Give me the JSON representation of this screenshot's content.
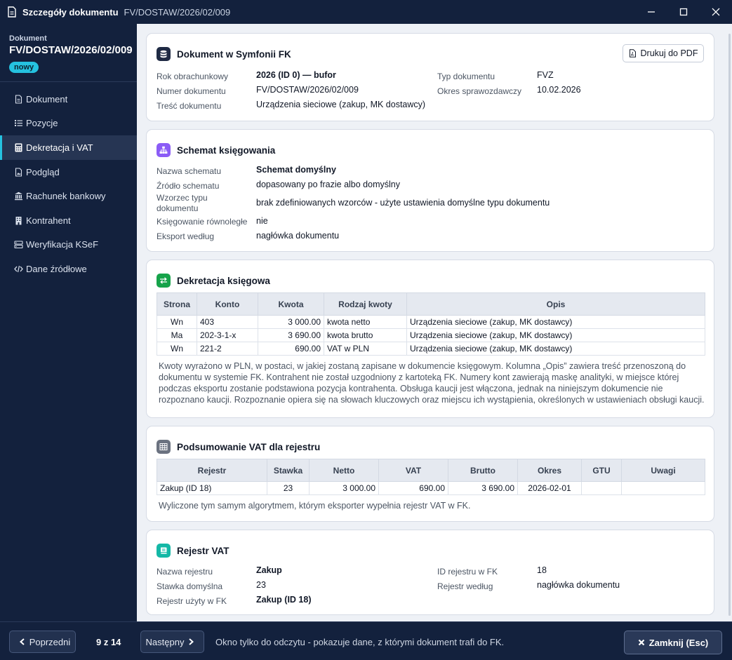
{
  "window": {
    "title": "Szczegóły dokumentu",
    "subtitle": "FV/DOSTAW/2026/02/009"
  },
  "sidebar": {
    "label": "Dokument",
    "doc_number": "FV/DOSTAW/2026/02/009",
    "badge": "nowy",
    "items": [
      {
        "label": "Dokument",
        "icon": "document-icon"
      },
      {
        "label": "Pozycje",
        "icon": "list-icon"
      },
      {
        "label": "Dekretacja i VAT",
        "icon": "calculator-icon",
        "active": true
      },
      {
        "label": "Podgląd",
        "icon": "image-icon"
      },
      {
        "label": "Rachunek bankowy",
        "icon": "bank-icon"
      },
      {
        "label": "Kontrahent",
        "icon": "building-icon"
      },
      {
        "label": "Weryfikacja KSeF",
        "icon": "server-icon"
      },
      {
        "label": "Dane źródłowe",
        "icon": "code-icon"
      }
    ]
  },
  "card1": {
    "title": "Dokument w Symfonii FK",
    "pdf_button": "Drukuj do PDF",
    "fields": {
      "rok_k": "Rok obrachunkowy",
      "rok_v": "2026 (ID 0) — bufor",
      "numer_k": "Numer dokumentu",
      "numer_v": "FV/DOSTAW/2026/02/009",
      "tresc_k": "Treść dokumentu",
      "tresc_v": "Urządzenia sieciowe (zakup, MK dostawcy)",
      "typ_k": "Typ dokumentu",
      "typ_v": "FVZ",
      "okres_k": "Okres sprawozdawczy",
      "okres_v": "10.02.2026"
    }
  },
  "card2": {
    "title": "Schemat księgowania",
    "fields": {
      "nazwa_k": "Nazwa schematu",
      "nazwa_v": "Schemat domyślny",
      "zrodlo_k": "Źródło schematu",
      "zrodlo_v": "dopasowany po frazie albo domyślny",
      "wzorzec_k1": "Wzorzec typu",
      "wzorzec_k2": "dokumentu",
      "wzorzec_v": "brak zdefiniowanych wzorców - użyte ustawienia domyślne typu dokumentu",
      "rown_k": "Księgowanie równoległe",
      "rown_v": "nie",
      "eksport_k": "Eksport według",
      "eksport_v": "nagłówka dokumentu"
    }
  },
  "card3": {
    "title": "Dekretacja księgowa",
    "headers": [
      "Strona",
      "Konto",
      "Kwota",
      "Rodzaj kwoty",
      "Opis"
    ],
    "rows": [
      [
        "Wn",
        "403",
        "3 000.00",
        "kwota netto",
        "Urządzenia sieciowe (zakup, MK dostawcy)"
      ],
      [
        "Ma",
        "202-3-1-x",
        "3 690.00",
        "kwota brutto",
        "Urządzenia sieciowe (zakup, MK dostawcy)"
      ],
      [
        "Wn",
        "221-2",
        "690.00",
        "VAT w PLN",
        "Urządzenia sieciowe (zakup, MK dostawcy)"
      ]
    ],
    "note_lines": [
      "Kwoty wyrażono w PLN, w postaci, w jakiej zostaną zapisane w dokumencie księgowym. Kolumna „Opis” zawiera treść przenoszoną do",
      "dokumentu w systemie FK. Kontrahent nie został uzgodniony z kartoteką FK. Numery kont zawierają maskę analityki, w miejsce której",
      "podczas eksportu zostanie podstawiona pozycja kontrahenta. Obsługa kaucji jest włączona, jednak na niniejszym dokumencie nie",
      "rozpoznano kaucji. Rozpoznanie opiera się na słowach kluczowych oraz miejscu ich wystąpienia, określonych w ustawieniach obsługi kaucji."
    ]
  },
  "card4": {
    "title": "Podsumowanie VAT dla rejestru",
    "headers": [
      "Rejestr",
      "Stawka",
      "Netto",
      "VAT",
      "Brutto",
      "Okres",
      "GTU",
      "Uwagi"
    ],
    "rows": [
      [
        "Zakup (ID 18)",
        "23",
        "3 000.00",
        "690.00",
        "3 690.00",
        "2026-02-01",
        "",
        ""
      ]
    ],
    "note": "Wyliczone tym samym algorytmem, którym eksporter wypełnia rejestr VAT w FK."
  },
  "card5": {
    "title": "Rejestr VAT",
    "fields": {
      "nazwa_k": "Nazwa rejestru",
      "nazwa_v": "Zakup",
      "stawka_k": "Stawka domyślna",
      "stawka_v": "23",
      "uzyty_k": "Rejestr użyty w FK",
      "uzyty_v": "Zakup (ID 18)",
      "id_k": "ID rejestru w FK",
      "id_v": "18",
      "wedlug_k": "Rejestr według",
      "wedlug_v": "nagłówka dokumentu"
    }
  },
  "footer": {
    "prev": "Poprzedni",
    "pager": "9 z 14",
    "next": "Następny",
    "note": "Okno tylko do odczytu - pokazuje dane, z którymi dokument trafi do FK.",
    "close": "Zamknij (Esc)"
  },
  "colors": {
    "background": "#13213d",
    "accent": "#25c2e0",
    "icon_card1": "#1f2a44",
    "icon_card2": "#8b5cf6",
    "icon_card3": "#16a34a",
    "icon_card4": "#6b7280",
    "icon_card5": "#14b8a6"
  }
}
